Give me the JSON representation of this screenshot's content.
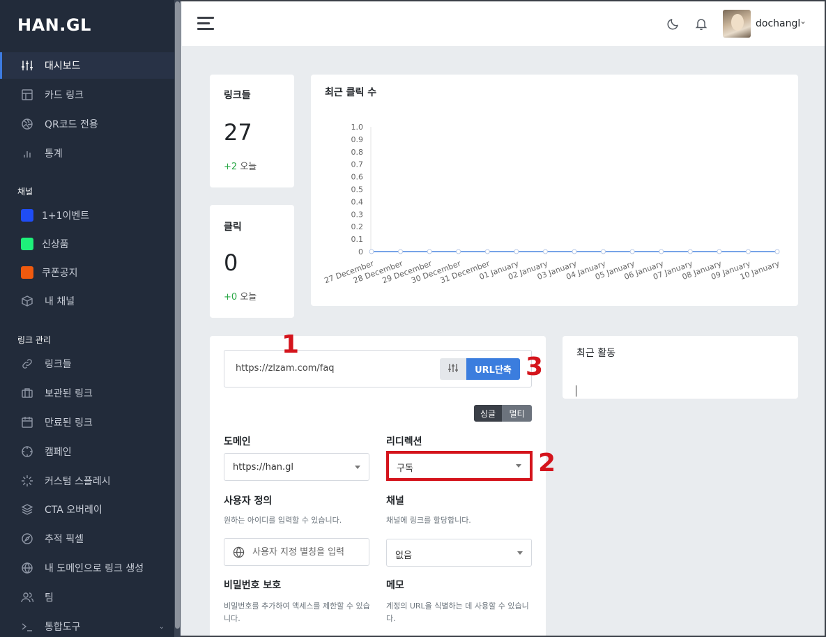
{
  "brand": {
    "logo": "HAN.GL"
  },
  "sidebar": {
    "main": [
      {
        "label": "대시보드",
        "icon": "sliders-icon",
        "active": true
      },
      {
        "label": "카드 링크",
        "icon": "layout-icon"
      },
      {
        "label": "QR코드 전용",
        "icon": "aperture-icon"
      },
      {
        "label": "통계",
        "icon": "bar-chart-icon"
      }
    ],
    "channels_title": "채널",
    "channels": [
      {
        "label": "1+1이벤트",
        "color": "#1f4df5"
      },
      {
        "label": "신상품",
        "color": "#1ef07a"
      },
      {
        "label": "쿠폰공지",
        "color": "#f05a0e"
      },
      {
        "label": "내 채널",
        "icon": "box-icon"
      }
    ],
    "links_title": "링크 관리",
    "links": [
      {
        "label": "링크들",
        "icon": "link-icon"
      },
      {
        "label": "보관된 링크",
        "icon": "briefcase-icon"
      },
      {
        "label": "만료된 링크",
        "icon": "calendar-icon"
      },
      {
        "label": "캠페인",
        "icon": "crosshair-icon"
      },
      {
        "label": "커스텀 스플레시",
        "icon": "loader-icon"
      },
      {
        "label": "CTA 오버레이",
        "icon": "layers-icon"
      },
      {
        "label": "추적 픽셀",
        "icon": "compass-icon"
      },
      {
        "label": "내 도메인으로 링크 생성",
        "icon": "globe-icon"
      },
      {
        "label": "팀",
        "icon": "users-icon"
      },
      {
        "label": "통합도구",
        "icon": "terminal-icon"
      }
    ]
  },
  "topbar": {
    "username": "dochangl"
  },
  "stats": {
    "links": {
      "title": "링크들",
      "value": "27",
      "delta": "+2",
      "delta_label": "오늘"
    },
    "clicks": {
      "title": "클릭",
      "value": "0",
      "delta": "+0",
      "delta_label": "오늘"
    }
  },
  "recent_clicks": {
    "title": "최근 클릭 수"
  },
  "chart_data": {
    "type": "line",
    "title": "",
    "categories": [
      "27 December",
      "28 December",
      "29 December",
      "30 December",
      "31 December",
      "01 January",
      "02 January",
      "03 January",
      "04 January",
      "05 January",
      "06 January",
      "07 January",
      "08 January",
      "09 January",
      "10 January"
    ],
    "series": [
      {
        "values": [
          0,
          0,
          0,
          0,
          0,
          0,
          0,
          0,
          0,
          0,
          0,
          0,
          0,
          0,
          0
        ],
        "color": "#4a86e0"
      }
    ],
    "y_ticks": [
      "0",
      "0.1",
      "0.2",
      "0.3",
      "0.4",
      "0.5",
      "0.6",
      "0.7",
      "0.8",
      "0.9",
      "1.0"
    ],
    "ylim": [
      0,
      1
    ]
  },
  "shorten": {
    "url_value": "https://zlzam.com/faq",
    "shorten_label": "URL단축",
    "single_label": "싱글",
    "multi_label": "멀티",
    "domain_label": "도메인",
    "domain_value": "https://han.gl",
    "redirect_label": "리디렉션",
    "redirect_value": "구독",
    "custom_label": "사용자 정의",
    "custom_help": "원하는 아이디를 입력할 수 있습니다.",
    "custom_placeholder": "사용자 지정 별칭을 입력",
    "channel_label": "채널",
    "channel_help": "채널에 링크를 할당합니다.",
    "channel_value": "없음",
    "password_label": "비밀번호 보호",
    "password_help": "비밀번호를 추가하여 액세스를 제한할 수 있습니다.",
    "memo_label": "메모",
    "memo_help": "계정의 URL을 식별하는 데 사용할 수 있습니다."
  },
  "recent_activity": {
    "title": "최근 활동"
  },
  "annotations": {
    "a1": "1",
    "a2": "2",
    "a3": "3",
    "color": "#d4141c"
  }
}
